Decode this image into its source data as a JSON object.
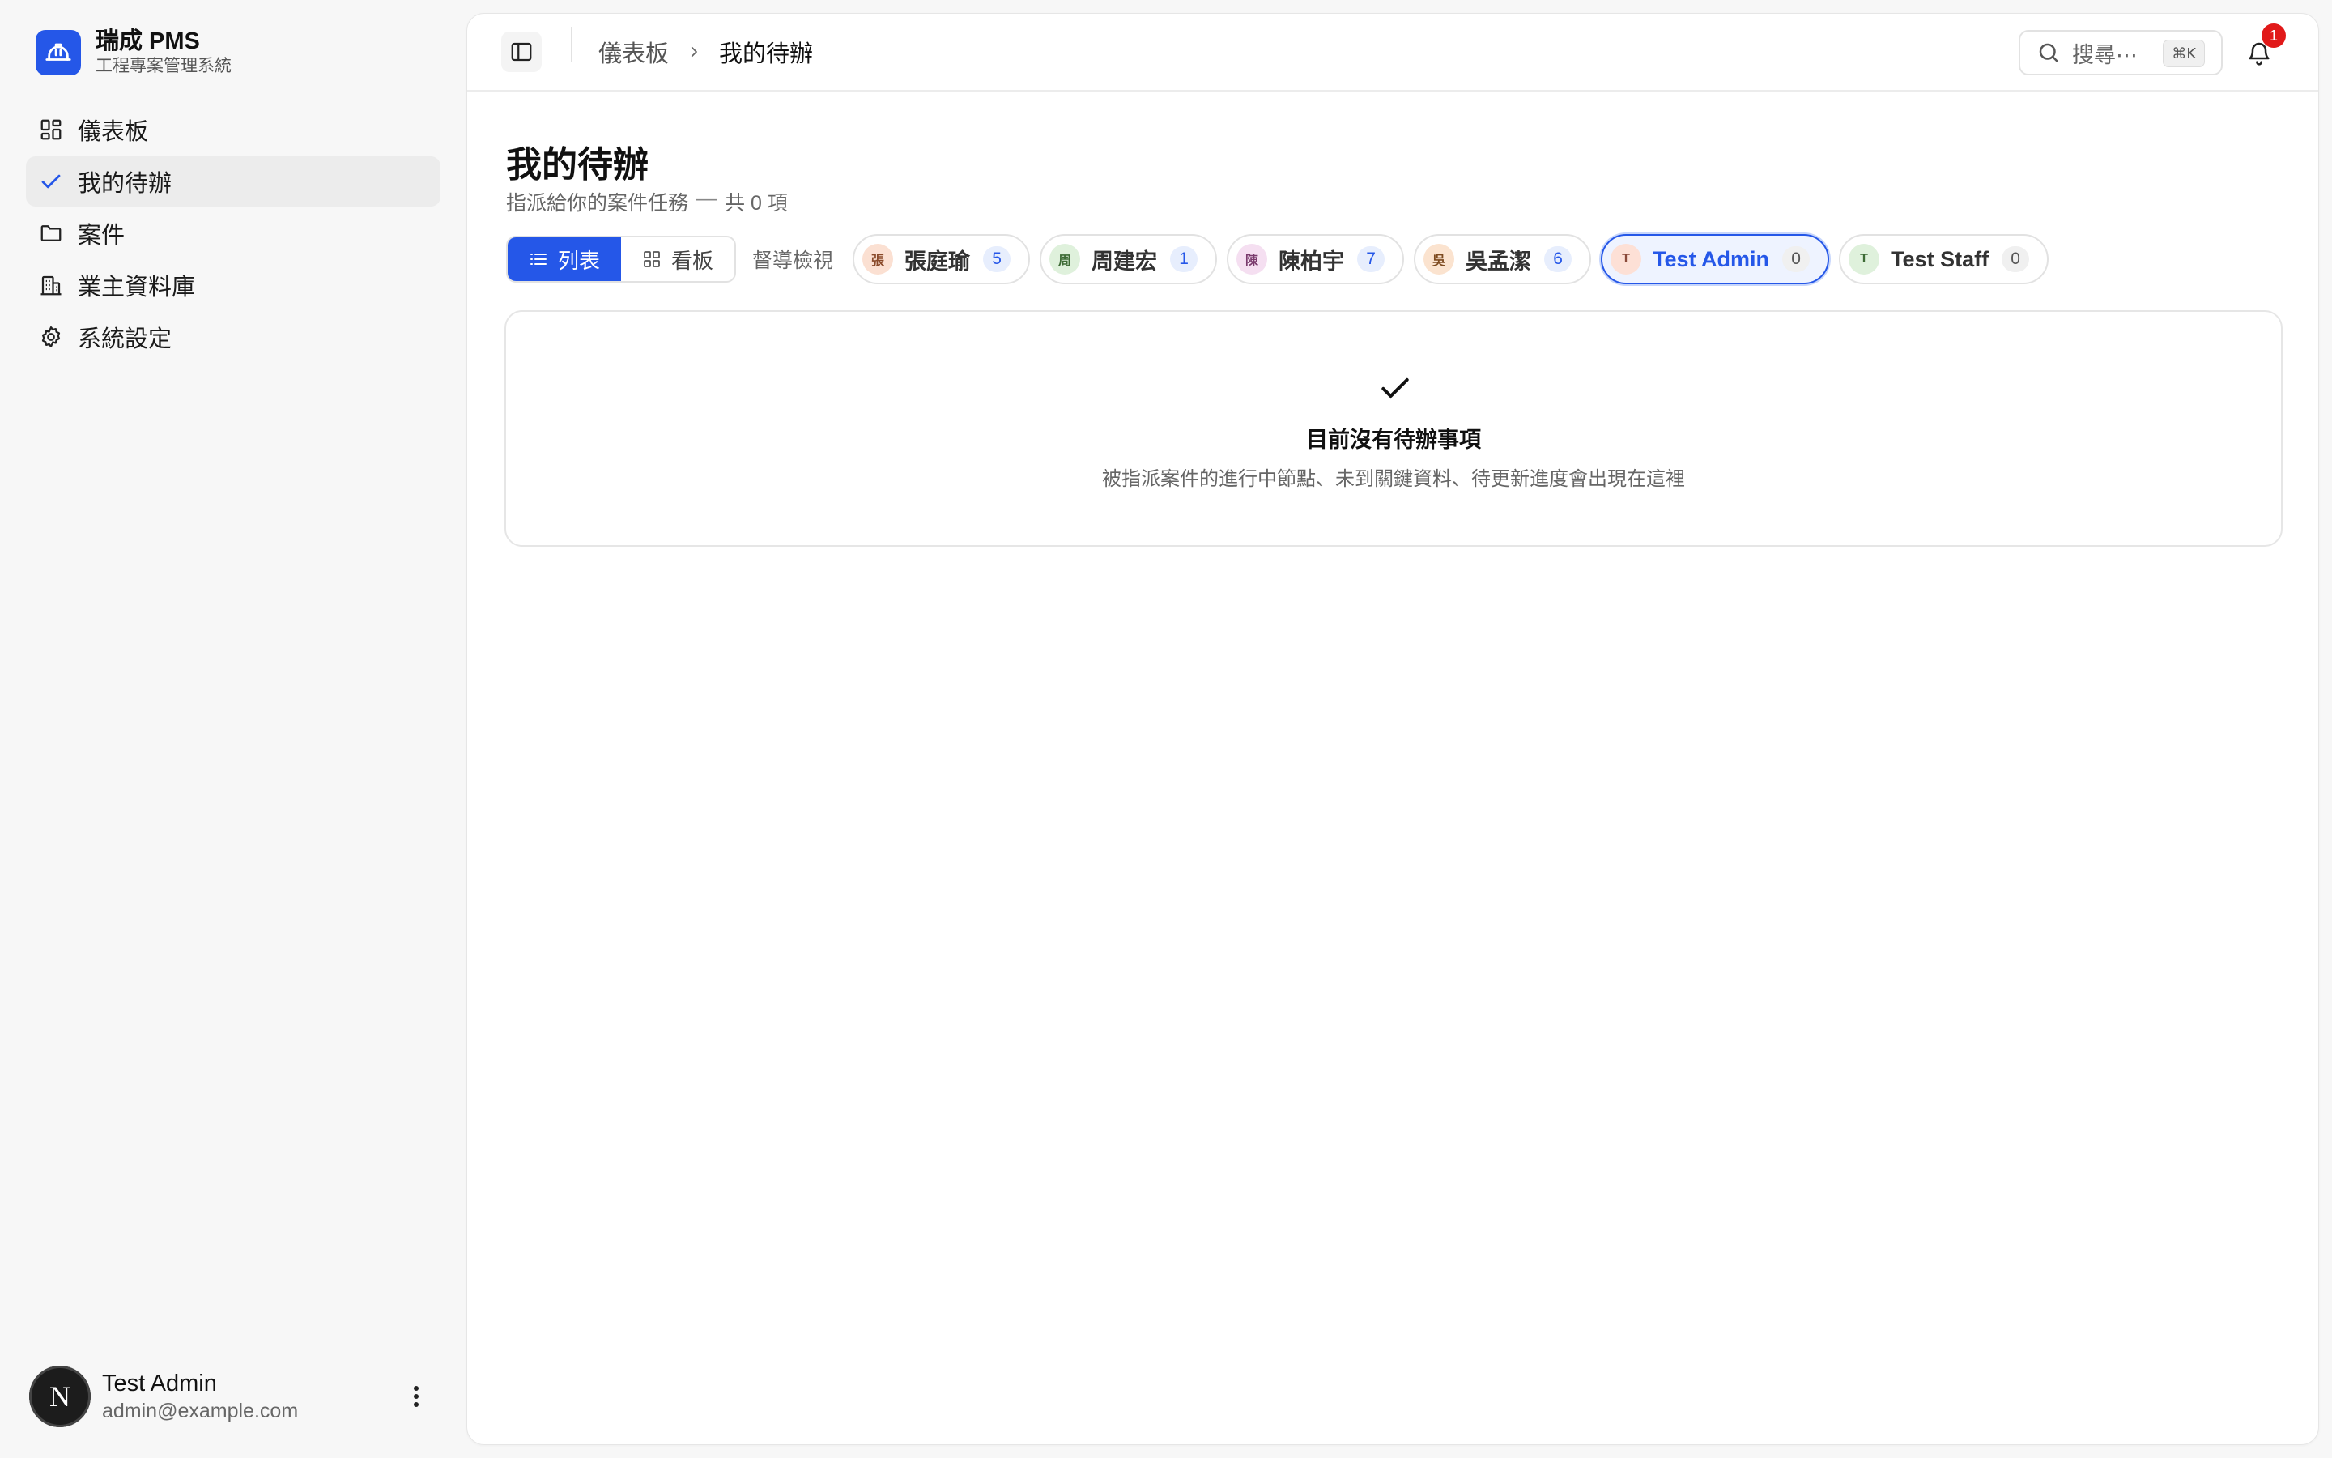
{
  "brand": {
    "name": "瑞成 PMS",
    "subtitle": "工程專案管理系統",
    "logo_icon": "hard-hat-icon",
    "accent": "#2557e8"
  },
  "nav": [
    {
      "label": "儀表板",
      "icon": "dashboard-icon",
      "active": false
    },
    {
      "label": "我的待辦",
      "icon": "check-icon",
      "active": true
    },
    {
      "label": "案件",
      "icon": "folder-icon",
      "active": false
    },
    {
      "label": "業主資料庫",
      "icon": "building-icon",
      "active": false
    },
    {
      "label": "系統設定",
      "icon": "gear-icon",
      "active": false
    }
  ],
  "user": {
    "avatar_letter": "N",
    "name": "Test Admin",
    "email": "admin@example.com"
  },
  "topbar": {
    "breadcrumb": {
      "parent": "儀表板",
      "current": "我的待辦"
    },
    "search_placeholder": "搜尋⋯",
    "search_shortcut": "⌘K",
    "notification_count": "1"
  },
  "page": {
    "title": "我的待辦",
    "subtitle": "指派給你的案件任務",
    "subtitle_sep": "—",
    "subtitle_count": "共 0 項"
  },
  "view_toggle": {
    "list_label": "列表",
    "board_label": "看板",
    "active": "list"
  },
  "supervisor_label": "督導檢視",
  "people": [
    {
      "avatar": "張",
      "name": "張庭瑜",
      "count": "5",
      "avatar_bg": "#fbe0d2",
      "avatar_fg": "#8a4a2a",
      "selected": false
    },
    {
      "avatar": "周",
      "name": "周建宏",
      "count": "1",
      "avatar_bg": "#dff1dc",
      "avatar_fg": "#3d6b35",
      "selected": false
    },
    {
      "avatar": "陳",
      "name": "陳柏宇",
      "count": "7",
      "avatar_bg": "#f5dff1",
      "avatar_fg": "#7a3b6d",
      "selected": false
    },
    {
      "avatar": "吳",
      "name": "吳孟潔",
      "count": "6",
      "avatar_bg": "#fbe3cf",
      "avatar_fg": "#7d4a1f",
      "selected": false
    },
    {
      "avatar": "T",
      "name": "Test Admin",
      "count": "0",
      "avatar_bg": "#fde0d6",
      "avatar_fg": "#8a4a3a",
      "selected": true
    },
    {
      "avatar": "T",
      "name": "Test Staff",
      "count": "0",
      "avatar_bg": "#dff1dc",
      "avatar_fg": "#3d6b35",
      "selected": false
    }
  ],
  "empty_state": {
    "icon": "check-icon",
    "title": "目前沒有待辦事項",
    "description": "被指派案件的進行中節點、未到關鍵資料、待更新進度會出現在這裡"
  }
}
